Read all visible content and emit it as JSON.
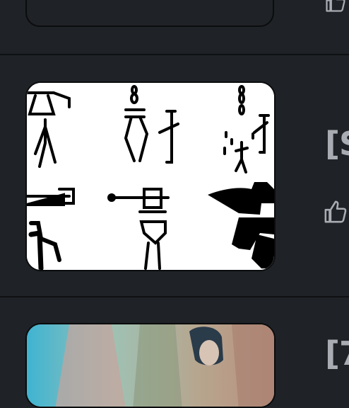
{
  "posts": [
    {
      "title_fragment": ""
    },
    {
      "title_fragment": "[S"
    },
    {
      "title_fragment": "[7"
    }
  ],
  "icons": {
    "like": "thumbs-up-icon"
  },
  "colors": {
    "background": "#1f2226",
    "divider": "#0f1012",
    "text_muted": "#a9adb3"
  }
}
